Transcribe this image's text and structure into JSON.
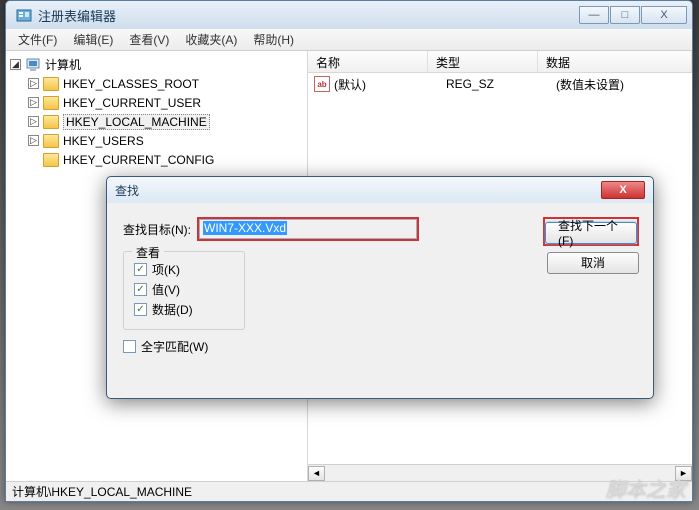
{
  "window": {
    "title": "注册表编辑器",
    "controls": {
      "min": "—",
      "max": "□",
      "close": "X"
    }
  },
  "menu": {
    "file": "文件(F)",
    "edit": "编辑(E)",
    "view": "查看(V)",
    "fav": "收藏夹(A)",
    "help": "帮助(H)"
  },
  "tree": {
    "root": "计算机",
    "items": [
      {
        "label": "HKEY_CLASSES_ROOT"
      },
      {
        "label": "HKEY_CURRENT_USER"
      },
      {
        "label": "HKEY_LOCAL_MACHINE",
        "selected": true
      },
      {
        "label": "HKEY_USERS"
      },
      {
        "label": "HKEY_CURRENT_CONFIG"
      }
    ]
  },
  "list": {
    "cols": {
      "name": "名称",
      "type": "类型",
      "data": "数据"
    },
    "row": {
      "icon": "ab",
      "name": "(默认)",
      "type": "REG_SZ",
      "data": "(数值未设置)"
    }
  },
  "status": "计算机\\HKEY_LOCAL_MACHINE",
  "dialog": {
    "title": "查找",
    "target_label": "查找目标(N):",
    "target_value": "WIN7-XXX.Vxd",
    "findnext": "查找下一个(F)",
    "cancel": "取消",
    "group": "查看",
    "chk_key": "项(K)",
    "chk_val": "值(V)",
    "chk_data": "数据(D)",
    "whole": "全字匹配(W)"
  },
  "watermark": "脚本之家"
}
